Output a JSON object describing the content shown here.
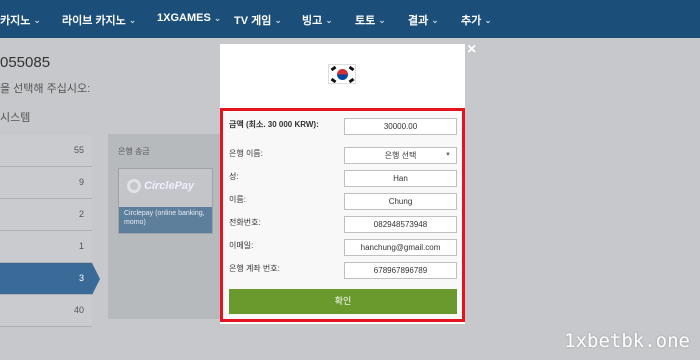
{
  "nav": {
    "items": [
      {
        "label": "카지노",
        "chev": "⌄"
      },
      {
        "label": "라이브 카지노",
        "chev": "⌄"
      },
      {
        "label": "1XGAMES",
        "chev": "⌄"
      },
      {
        "label": "TV 게임",
        "chev": "⌄"
      },
      {
        "label": "빙고",
        "chev": "⌄"
      },
      {
        "label": "토토",
        "chev": "⌄"
      },
      {
        "label": "결과",
        "chev": "⌄"
      },
      {
        "label": "추가",
        "chev": "⌄"
      }
    ]
  },
  "background": {
    "account_id": "055085",
    "choose_text": "을 선택해 주십시오:",
    "system_text": "시스템",
    "methods": [
      {
        "count": "55"
      },
      {
        "count": "9"
      },
      {
        "count": "2"
      },
      {
        "count": "1"
      },
      {
        "count": "3"
      },
      {
        "count": "40"
      }
    ],
    "bank_panel_title": "은행 송금",
    "bank_card": {
      "logo": "CirclePay",
      "footer": "Circlepay (online banking, momo)"
    }
  },
  "modal": {
    "close": "×",
    "fields": [
      {
        "label": "금액 (최소. 30 000 KRW):",
        "value": "30000.00",
        "bold": true
      },
      {
        "label": "은행 이름:",
        "value": "은행 선택",
        "select": true
      },
      {
        "label": "성:",
        "value": "Han"
      },
      {
        "label": "이름:",
        "value": "Chung"
      },
      {
        "label": "전화번호:",
        "value": "082948573948"
      },
      {
        "label": "이메일:",
        "value": "hanchung@gmail.com"
      },
      {
        "label": "은행 계좌 번호:",
        "value": "678967896789"
      }
    ],
    "confirm_label": "확인"
  },
  "watermark": "1xbetbk.one",
  "colors": {
    "nav_bg": "#1b4f79",
    "highlight_border": "#e3131f",
    "confirm_bg": "#6a9a2d",
    "active_method": "#3a6b98"
  }
}
